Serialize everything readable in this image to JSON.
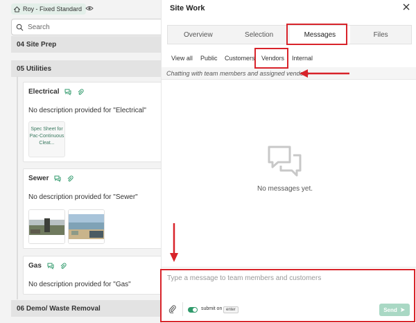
{
  "left": {
    "project_chip": "Roy - Fixed Standard",
    "search_placeholder": "Search",
    "sections": [
      "04 Site Prep",
      "05 Utilities",
      "06 Demo/ Waste Removal"
    ],
    "cards": [
      {
        "title": "Electrical",
        "description": "No description provided for \"Electrical\"",
        "attachment": "Spec Sheet for Pac-Continuous Cleat..."
      },
      {
        "title": "Sewer",
        "description": "No description provided for \"Sewer\""
      },
      {
        "title": "Gas",
        "description": "No description provided for \"Gas\""
      }
    ]
  },
  "panel": {
    "title": "Site Work",
    "tabs": [
      "Overview",
      "Selection",
      "Messages",
      "Files"
    ],
    "active_tab": "Messages",
    "subtabs": [
      "View all",
      "Public",
      "Customers",
      "Vendors",
      "Internal"
    ],
    "active_subtab": "Vendors",
    "chat_info": "Chatting with team members and assigned vendors",
    "empty_text": "No messages yet.",
    "composer_placeholder": "Type a message to team members and customers",
    "submit_on_label": "submit on",
    "enter_key": "enter",
    "send_label": "Send"
  },
  "colors": {
    "accent": "#2f9a6b",
    "annotation": "#d8232a"
  }
}
